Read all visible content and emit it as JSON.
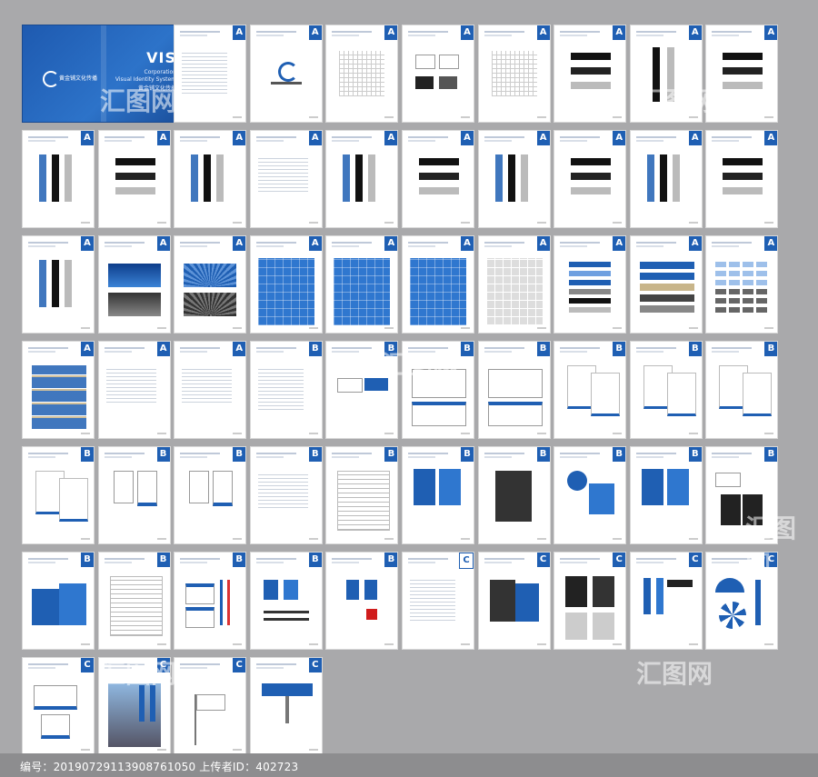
{
  "cover": {
    "title": "VIS",
    "line1": "Corporation",
    "line2": "Visual Identity System",
    "line3": "黄金铺文化传播",
    "logo_text": "黄金铺文化传播"
  },
  "colors": {
    "brand": "#1f5fb3",
    "background": "#a9a9ab"
  },
  "pages": [
    {
      "row": 0,
      "col": 2,
      "tab": "A",
      "kind": "toc"
    },
    {
      "row": 0,
      "col": 3,
      "tab": "A",
      "kind": "logo"
    },
    {
      "row": 0,
      "col": 4,
      "tab": "A",
      "kind": "grid"
    },
    {
      "row": 0,
      "col": 5,
      "tab": "A",
      "kind": "logos"
    },
    {
      "row": 0,
      "col": 6,
      "tab": "A",
      "kind": "grid"
    },
    {
      "row": 0,
      "col": 7,
      "tab": "A",
      "kind": "bars"
    },
    {
      "row": 0,
      "col": 8,
      "tab": "A",
      "kind": "vbar"
    },
    {
      "row": 0,
      "col": 9,
      "tab": "A",
      "kind": "bars"
    },
    {
      "row": 1,
      "col": 0,
      "tab": "A",
      "kind": "vlogo"
    },
    {
      "row": 1,
      "col": 1,
      "tab": "A",
      "kind": "bars"
    },
    {
      "row": 1,
      "col": 2,
      "tab": "A",
      "kind": "vlogo"
    },
    {
      "row": 1,
      "col": 3,
      "tab": "A",
      "kind": "text"
    },
    {
      "row": 1,
      "col": 4,
      "tab": "A",
      "kind": "vlogo"
    },
    {
      "row": 1,
      "col": 5,
      "tab": "A",
      "kind": "bars"
    },
    {
      "row": 1,
      "col": 6,
      "tab": "A",
      "kind": "vlogo"
    },
    {
      "row": 1,
      "col": 7,
      "tab": "A",
      "kind": "bars"
    },
    {
      "row": 1,
      "col": 8,
      "tab": "A",
      "kind": "vlogo"
    },
    {
      "row": 1,
      "col": 9,
      "tab": "A",
      "kind": "bars"
    },
    {
      "row": 2,
      "col": 0,
      "tab": "A",
      "kind": "vlogo"
    },
    {
      "row": 2,
      "col": 1,
      "tab": "A",
      "kind": "bluepic"
    },
    {
      "row": 2,
      "col": 2,
      "tab": "A",
      "kind": "rays"
    },
    {
      "row": 2,
      "col": 3,
      "tab": "A",
      "kind": "pattern"
    },
    {
      "row": 2,
      "col": 4,
      "tab": "A",
      "kind": "pattern"
    },
    {
      "row": 2,
      "col": 5,
      "tab": "A",
      "kind": "pattern"
    },
    {
      "row": 2,
      "col": 6,
      "tab": "A",
      "kind": "graypattern"
    },
    {
      "row": 2,
      "col": 7,
      "tab": "A",
      "kind": "swatch"
    },
    {
      "row": 2,
      "col": 8,
      "tab": "A",
      "kind": "swatch2"
    },
    {
      "row": 2,
      "col": 9,
      "tab": "A",
      "kind": "smalllogos"
    },
    {
      "row": 3,
      "col": 0,
      "tab": "A",
      "kind": "table"
    },
    {
      "row": 3,
      "col": 1,
      "tab": "A",
      "kind": "text"
    },
    {
      "row": 3,
      "col": 2,
      "tab": "A",
      "kind": "text"
    },
    {
      "row": 3,
      "col": 3,
      "tab": "B",
      "kind": "toc"
    },
    {
      "row": 3,
      "col": 4,
      "tab": "B",
      "kind": "card"
    },
    {
      "row": 3,
      "col": 5,
      "tab": "B",
      "kind": "envelope"
    },
    {
      "row": 3,
      "col": 6,
      "tab": "B",
      "kind": "envelope"
    },
    {
      "row": 3,
      "col": 7,
      "tab": "B",
      "kind": "letter"
    },
    {
      "row": 3,
      "col": 8,
      "tab": "B",
      "kind": "letter"
    },
    {
      "row": 3,
      "col": 9,
      "tab": "B",
      "kind": "letter"
    },
    {
      "row": 4,
      "col": 0,
      "tab": "B",
      "kind": "letter"
    },
    {
      "row": 4,
      "col": 1,
      "tab": "B",
      "kind": "tag"
    },
    {
      "row": 4,
      "col": 2,
      "tab": "B",
      "kind": "tag"
    },
    {
      "row": 4,
      "col": 3,
      "tab": "B",
      "kind": "text"
    },
    {
      "row": 4,
      "col": 4,
      "tab": "B",
      "kind": "form"
    },
    {
      "row": 4,
      "col": 5,
      "tab": "B",
      "kind": "folder"
    },
    {
      "row": 4,
      "col": 6,
      "tab": "B",
      "kind": "notebook"
    },
    {
      "row": 4,
      "col": 7,
      "tab": "B",
      "kind": "cd"
    },
    {
      "row": 4,
      "col": 8,
      "tab": "B",
      "kind": "folder"
    },
    {
      "row": 4,
      "col": 9,
      "tab": "B",
      "kind": "pad"
    },
    {
      "row": 5,
      "col": 0,
      "tab": "B",
      "kind": "bags"
    },
    {
      "row": 5,
      "col": 1,
      "tab": "B",
      "kind": "form"
    },
    {
      "row": 5,
      "col": 2,
      "tab": "B",
      "kind": "badge"
    },
    {
      "row": 5,
      "col": 3,
      "tab": "B",
      "kind": "cups"
    },
    {
      "row": 5,
      "col": 4,
      "tab": "B",
      "kind": "flags"
    },
    {
      "row": 5,
      "col": 5,
      "tab": "C",
      "kind": "toc",
      "light": true
    },
    {
      "row": 5,
      "col": 6,
      "tab": "C",
      "kind": "bags2"
    },
    {
      "row": 5,
      "col": 7,
      "tab": "C",
      "kind": "uniform"
    },
    {
      "row": 5,
      "col": 8,
      "tab": "C",
      "kind": "tie"
    },
    {
      "row": 5,
      "col": 9,
      "tab": "C",
      "kind": "umbrella"
    },
    {
      "row": 6,
      "col": 0,
      "tab": "C",
      "kind": "car"
    },
    {
      "row": 6,
      "col": 1,
      "tab": "C",
      "kind": "photo"
    },
    {
      "row": 6,
      "col": 2,
      "tab": "C",
      "kind": "flagpole"
    },
    {
      "row": 6,
      "col": 3,
      "tab": "C",
      "kind": "billboard"
    }
  ],
  "watermarks": [
    "汇图网",
    "汇图网",
    "汇图网",
    "汇图网",
    "汇图网",
    "汇图网"
  ],
  "footer": {
    "text": "编号：20190729113908761050 上传者ID：402723"
  }
}
